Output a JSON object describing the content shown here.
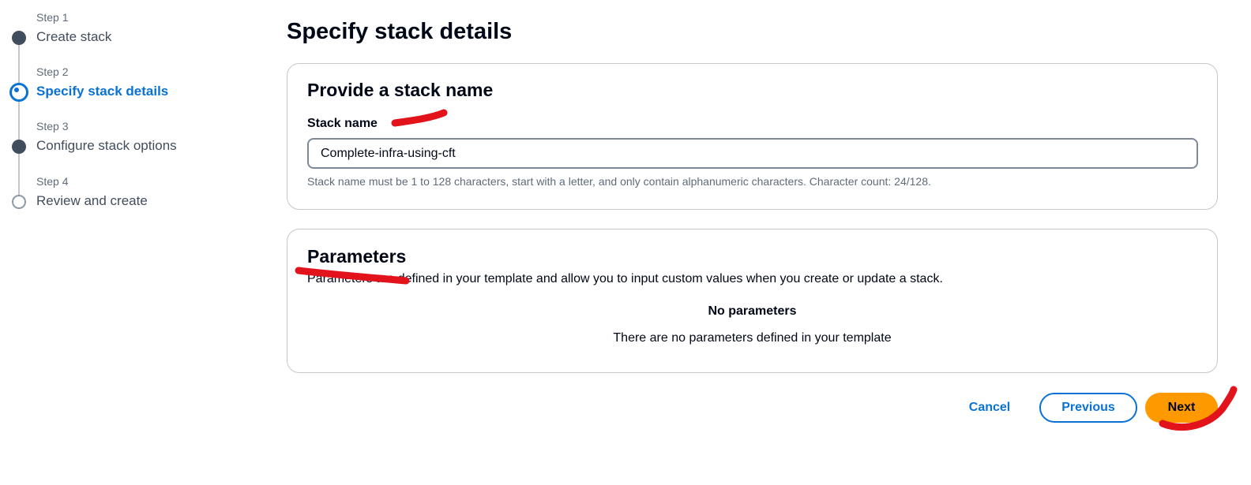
{
  "wizard": {
    "steps": [
      {
        "number": "Step 1",
        "title": "Create stack",
        "state": "completed"
      },
      {
        "number": "Step 2",
        "title": "Specify stack details",
        "state": "current"
      },
      {
        "number": "Step 3",
        "title": "Configure stack options",
        "state": "completed"
      },
      {
        "number": "Step 4",
        "title": "Review and create",
        "state": "upcoming"
      }
    ]
  },
  "main": {
    "title": "Specify stack details",
    "stack_name_panel": {
      "heading": "Provide a stack name",
      "field_label": "Stack name",
      "value": "Complete-infra-using-cft",
      "constraint": "Stack name must be 1 to 128 characters, start with a letter, and only contain alphanumeric characters. Character count: 24/128."
    },
    "parameters_panel": {
      "heading": "Parameters",
      "description": "Parameters are defined in your template and allow you to input custom values when you create or update a stack.",
      "empty_title": "No parameters",
      "empty_description": "There are no parameters defined in your template"
    }
  },
  "actions": {
    "cancel": "Cancel",
    "previous": "Previous",
    "next": "Next"
  },
  "colors": {
    "accent": "#0972d3",
    "primary_button": "#ff9900",
    "annotation": "#e3131b"
  }
}
